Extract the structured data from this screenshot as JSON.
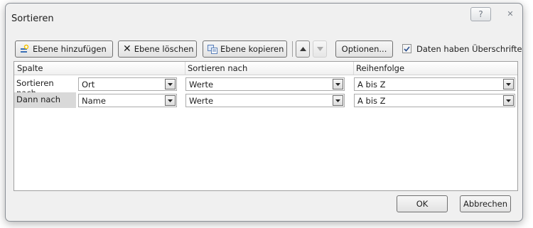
{
  "dialog": {
    "title": "Sortieren",
    "help_label": "?",
    "close_label": "✕"
  },
  "toolbar": {
    "add_level": "Ebene hinzufügen",
    "delete_level": "Ebene löschen",
    "copy_level": "Ebene kopieren",
    "options": "Optionen...",
    "has_headers_label": "Daten haben Überschriften",
    "has_headers_checked": true
  },
  "grid": {
    "headers": {
      "column": "Spalte",
      "sort_on": "Sortieren nach",
      "order": "Reihenfolge"
    },
    "rows": [
      {
        "label": "Sortieren nach",
        "column": "Ort",
        "sort_on": "Werte",
        "order": "A bis Z"
      },
      {
        "label": "Dann nach",
        "column": "Name",
        "sort_on": "Werte",
        "order": "A bis Z"
      }
    ]
  },
  "footer": {
    "ok": "OK",
    "cancel": "Abbrechen"
  }
}
